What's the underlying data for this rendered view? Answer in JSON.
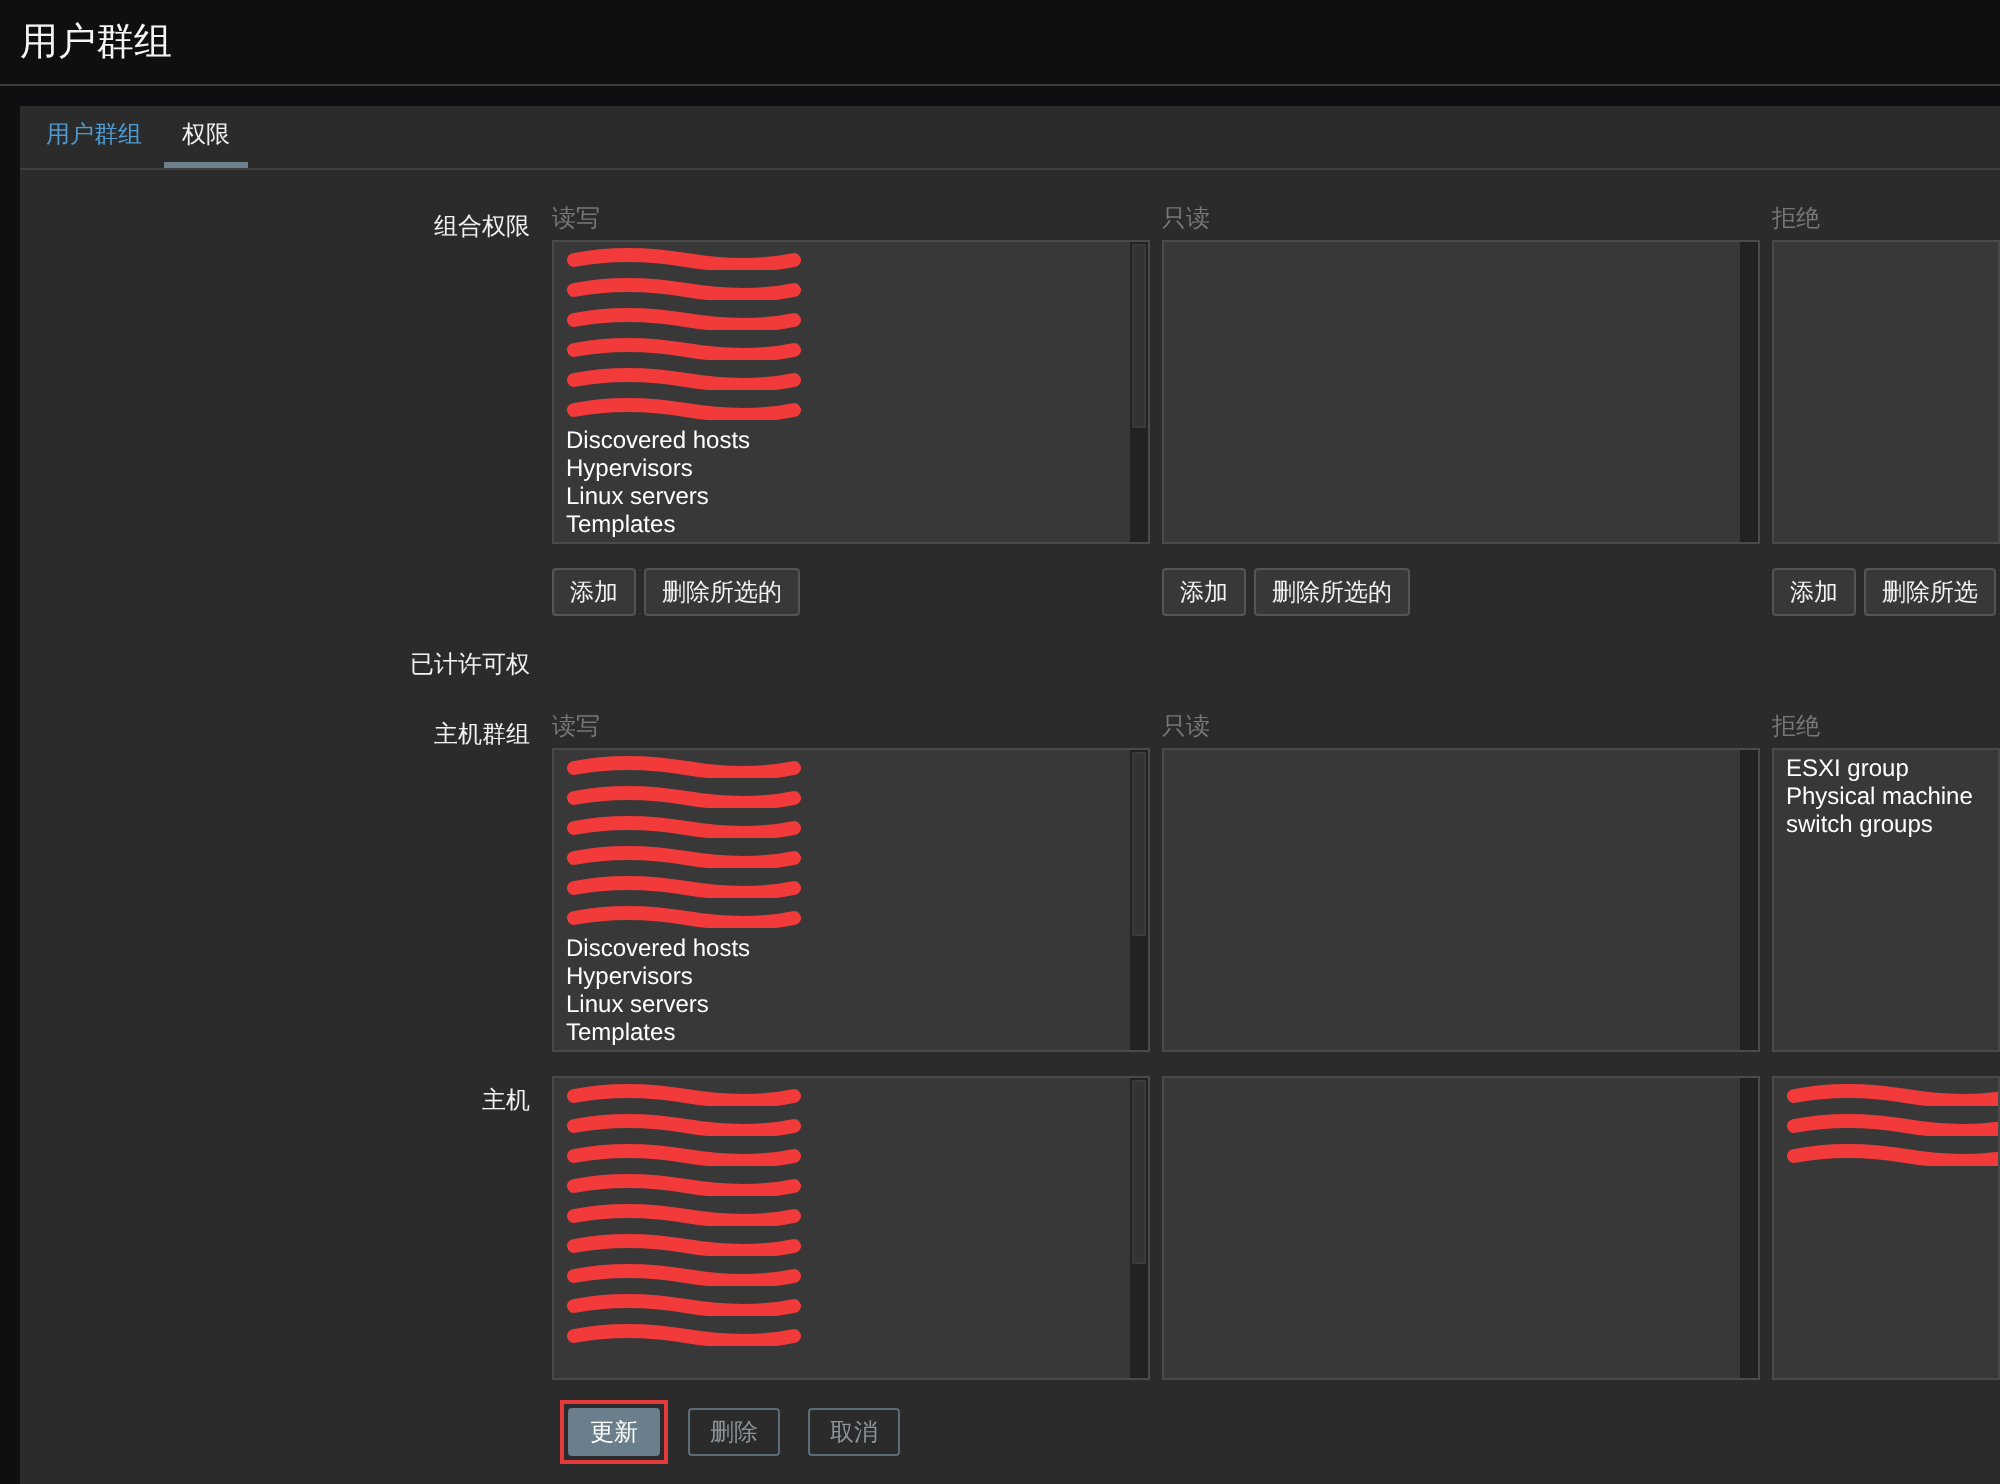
{
  "page_title": "用户群组",
  "tabs": [
    {
      "label": "用户群组",
      "selected": false
    },
    {
      "label": "权限",
      "selected": true
    }
  ],
  "sections": [
    {
      "kind": "editor",
      "label": "组合权限",
      "columns": [
        {
          "header": "读写",
          "items": [
            {
              "kind": "redacted"
            },
            {
              "kind": "redacted"
            },
            {
              "kind": "redacted"
            },
            {
              "kind": "redacted"
            },
            {
              "kind": "redacted"
            },
            {
              "kind": "redacted"
            },
            {
              "kind": "text",
              "text": "Discovered hosts"
            },
            {
              "kind": "text",
              "text": "Hypervisors"
            },
            {
              "kind": "text",
              "text": "Linux servers"
            },
            {
              "kind": "text",
              "text": "Templates"
            }
          ],
          "buttons": [
            "添加",
            "删除所选的"
          ]
        },
        {
          "header": "只读",
          "buttons": [
            "添加",
            "删除所选的"
          ]
        },
        {
          "header": "拒绝",
          "buttons": [
            "添加",
            "删除所选"
          ]
        }
      ]
    },
    {
      "kind": "heading",
      "label": "已计许可权"
    },
    {
      "kind": "lists",
      "label": "主机群组",
      "columns": [
        {
          "header": "读写",
          "items": [
            {
              "kind": "redacted"
            },
            {
              "kind": "redacted"
            },
            {
              "kind": "redacted"
            },
            {
              "kind": "redacted"
            },
            {
              "kind": "redacted"
            },
            {
              "kind": "redacted"
            },
            {
              "kind": "text",
              "text": "Discovered hosts"
            },
            {
              "kind": "text",
              "text": "Hypervisors"
            },
            {
              "kind": "text",
              "text": "Linux servers"
            },
            {
              "kind": "text",
              "text": "Templates"
            }
          ]
        },
        {
          "header": "只读"
        },
        {
          "header": "拒绝",
          "items": [
            {
              "kind": "text",
              "text": "ESXI group"
            },
            {
              "kind": "text",
              "text": "Physical machine"
            },
            {
              "kind": "text",
              "text": "switch groups"
            }
          ]
        }
      ]
    },
    {
      "kind": "lists",
      "label": "主机",
      "columns": [
        {
          "items": [
            {
              "kind": "redacted"
            },
            {
              "kind": "redacted"
            },
            {
              "kind": "redacted"
            },
            {
              "kind": "redacted"
            },
            {
              "kind": "redacted"
            },
            {
              "kind": "redacted"
            },
            {
              "kind": "redacted"
            },
            {
              "kind": "redacted"
            },
            {
              "kind": "redacted"
            }
          ]
        },
        {},
        {
          "items": [
            {
              "kind": "redacted"
            },
            {
              "kind": "redacted"
            },
            {
              "kind": "redacted"
            }
          ]
        }
      ]
    }
  ],
  "actions": [
    {
      "label": "更新",
      "kind": "primary",
      "highlighted": true
    },
    {
      "label": "删除",
      "kind": "secondary",
      "highlighted": false
    },
    {
      "label": "取消",
      "kind": "secondary",
      "highlighted": false
    }
  ]
}
